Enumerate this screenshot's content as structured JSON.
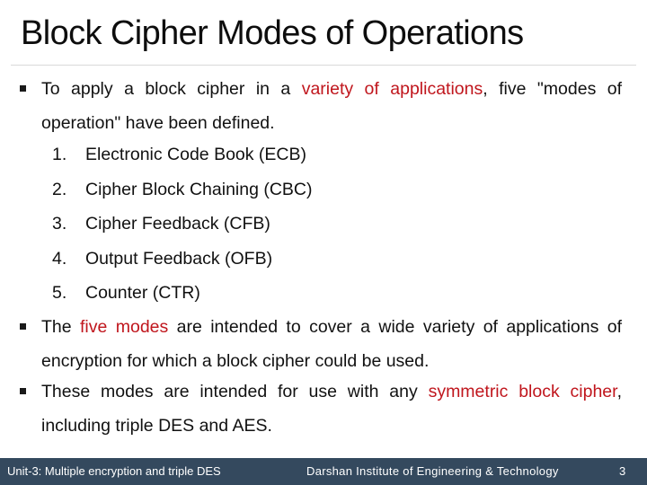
{
  "slide": {
    "title": "Block Cipher Modes of Operations",
    "bullets": [
      {
        "parts": [
          {
            "text": "To apply a block cipher in a ",
            "highlight": false
          },
          {
            "text": "variety of applications",
            "highlight": true
          },
          {
            "text": ", five \"modes of operation\" have been defined.",
            "highlight": false
          }
        ]
      },
      {
        "parts": [
          {
            "text": "The ",
            "highlight": false
          },
          {
            "text": "five modes",
            "highlight": true
          },
          {
            "text": " are intended to cover a wide variety of applications of encryption for which a block cipher could be used.",
            "highlight": false
          }
        ]
      },
      {
        "parts": [
          {
            "text": "These modes are intended for use with any ",
            "highlight": false
          },
          {
            "text": "symmetric block cipher",
            "highlight": true
          },
          {
            "text": ", including triple DES and AES.",
            "highlight": false
          }
        ]
      }
    ],
    "modes": [
      {
        "number": "1.",
        "label": "Electronic Code Book (ECB)"
      },
      {
        "number": "2.",
        "label": "Cipher Block Chaining (CBC)"
      },
      {
        "number": "3.",
        "label": "Cipher Feedback (CFB)"
      },
      {
        "number": "4.",
        "label": "Output Feedback (OFB)"
      },
      {
        "number": "5.",
        "label": "Counter (CTR)"
      }
    ]
  },
  "footer": {
    "unit": "Unit-3: Multiple encryption and triple DES",
    "institute": "Darshan Institute of Engineering & Technology",
    "page_number": "3"
  },
  "colors": {
    "highlight": "#c0161d",
    "footer_bg": "#34495e",
    "divider": "#d9d9d9"
  }
}
